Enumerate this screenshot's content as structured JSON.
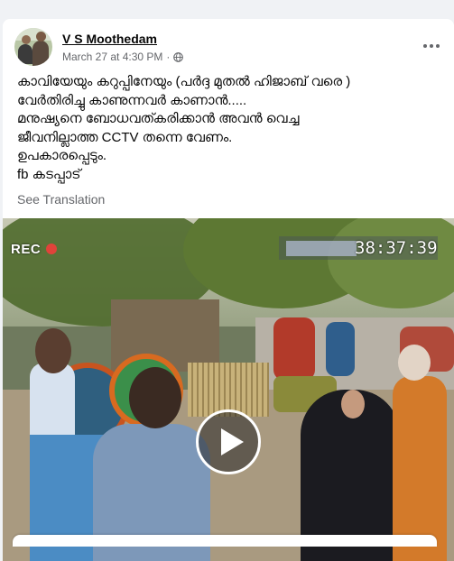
{
  "post": {
    "author": "V S Moothedam",
    "timestamp": "March 27 at 4:30 PM",
    "separator": "·",
    "privacy_icon": "globe-icon",
    "more_icon": "more-options-icon",
    "text_lines": [
      "കാവിയേയും കറുപ്പിനേയും (പർദ്ദ മുതൽ ഹിജാബ് വരെ )",
      "വേർതിരിച്ചു കാണുന്നവർ കാണാൻ.....",
      "മനുഷ്യനെ ബോധവത്കരിക്കാൻ അവൻ വെച്ച",
      "ജീവനില്ലാത്ത CCTV തന്നെ വേണം.",
      "ഉപകാരപ്പെടും.",
      "fb കടപ്പാട്"
    ],
    "see_translation": "See Translation"
  },
  "video": {
    "rec_label": "REC",
    "clock": "38:37:39",
    "play_icon": "play-icon",
    "colors": {
      "rec_dot": "#e0433a",
      "play_ring": "#ffffff"
    }
  }
}
